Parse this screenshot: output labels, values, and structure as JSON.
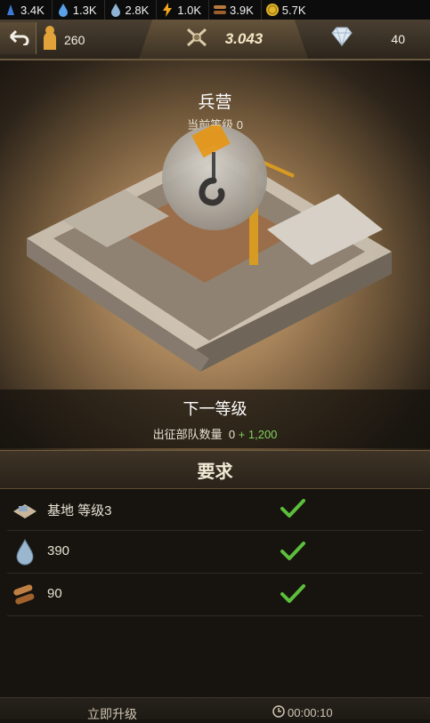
{
  "resources": [
    {
      "icon": "oil-icon",
      "value": "3.4K"
    },
    {
      "icon": "water-drop-icon",
      "value": "1.3K"
    },
    {
      "icon": "water-drop-icon",
      "value": "2.8K"
    },
    {
      "icon": "lightning-icon",
      "value": "1.0K"
    },
    {
      "icon": "wood-logs-icon",
      "value": "3.9K"
    },
    {
      "icon": "gold-coin-icon",
      "value": "5.7K"
    }
  ],
  "header": {
    "troops": "260",
    "power": "3.043",
    "gems": "40"
  },
  "building": {
    "name": "兵营",
    "current_level": "当前等级 0"
  },
  "next_level": {
    "title": "下一等级",
    "stat_label": "出征部队数量",
    "current": "0",
    "bonus": "+ 1,200"
  },
  "requirements": {
    "title": "要求",
    "items": [
      {
        "icon": "base-building-icon",
        "label": "基地 等级3",
        "met": true
      },
      {
        "icon": "water-drop-icon",
        "label": "390",
        "met": true
      },
      {
        "icon": "wood-logs-icon",
        "label": "90",
        "met": true
      }
    ]
  },
  "footer": {
    "upgrade_now": "立即升级",
    "timer": "00:00:10"
  },
  "colors": {
    "accent": "#7ed35c",
    "gold": "#f5e7c5",
    "check": "#5cbf3c"
  }
}
